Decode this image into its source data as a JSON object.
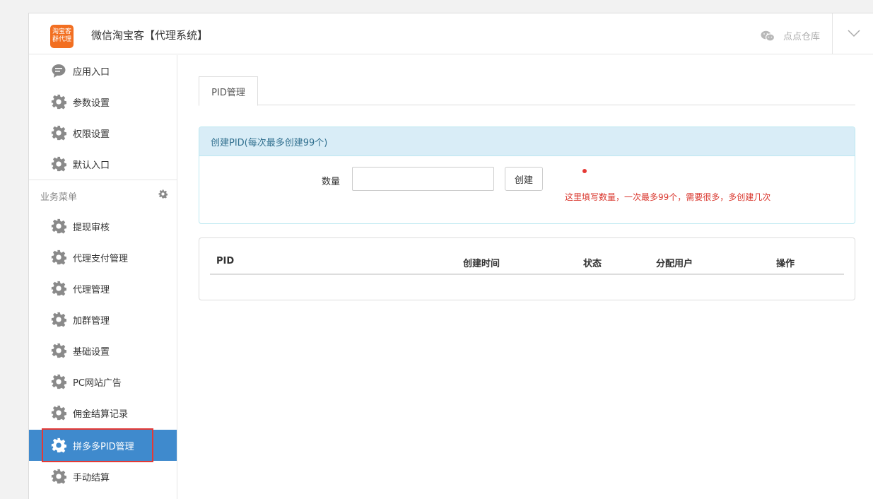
{
  "header": {
    "logo_line1": "淘宝客",
    "logo_line2": "群代理",
    "title": "微信淘宝客【代理系统】",
    "account_name": "点点仓库"
  },
  "sidebar": {
    "top_items": [
      {
        "label": "应用入口",
        "icon": "chat-bubble-icon"
      },
      {
        "label": "参数设置",
        "icon": "gear-icon"
      },
      {
        "label": "权限设置",
        "icon": "gear-icon"
      },
      {
        "label": "默认入口",
        "icon": "gear-icon"
      }
    ],
    "group_label": "业务菜单",
    "group_items": [
      {
        "label": "提现审核",
        "icon": "gear-icon"
      },
      {
        "label": "代理支付管理",
        "icon": "gear-icon"
      },
      {
        "label": "代理管理",
        "icon": "gear-icon"
      },
      {
        "label": "加群管理",
        "icon": "gear-icon"
      },
      {
        "label": "基础设置",
        "icon": "gear-icon"
      },
      {
        "label": "PC网站广告",
        "icon": "gear-icon"
      },
      {
        "label": "佣金结算记录",
        "icon": "gear-icon"
      },
      {
        "label": "拼多多PID管理",
        "icon": "gear-icon",
        "active": true
      },
      {
        "label": "手动结算",
        "icon": "gear-icon"
      }
    ]
  },
  "tabs": [
    {
      "label": "PID管理",
      "active": true
    }
  ],
  "create_panel": {
    "heading": "创建PID(每次最多创建99个)",
    "quantity_label": "数量",
    "quantity_value": "",
    "create_button": "创建",
    "hint": "这里填写数量，一次最多99个，需要很多，多创建几次"
  },
  "table": {
    "columns": [
      "PID",
      "创建时间",
      "状态",
      "分配用户",
      "操作"
    ],
    "rows": []
  },
  "colors": {
    "active_bg": "#3f8acd",
    "panel_heading_bg": "#d9edf7",
    "hint_red": "#d9342b",
    "logo_orange": "#f26f21"
  }
}
